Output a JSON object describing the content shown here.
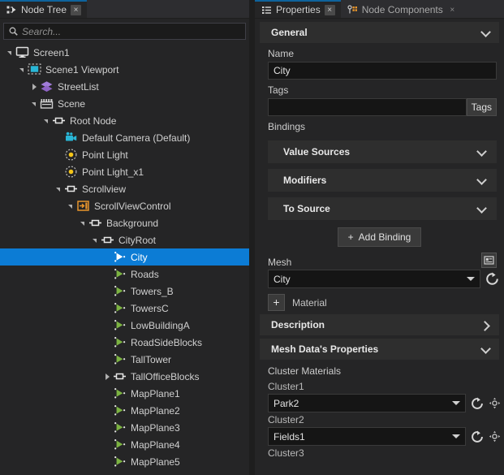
{
  "left_panel": {
    "tab": {
      "label": "Node Tree",
      "icon": "node-tree-icon",
      "close": "×"
    },
    "search": {
      "placeholder": "Search...",
      "value": "",
      "icon": "search-icon"
    },
    "tree": {
      "selected": "City",
      "nodes": [
        {
          "label": "Screen1",
          "depth": 0,
          "icon": "monitor-icon",
          "twisty": "down"
        },
        {
          "label": "Scene1 Viewport",
          "depth": 1,
          "icon": "viewport-icon",
          "twisty": "down"
        },
        {
          "label": "StreetList",
          "depth": 2,
          "icon": "layers-icon",
          "twisty": "right"
        },
        {
          "label": "Scene",
          "depth": 2,
          "icon": "clapper-icon",
          "twisty": "down"
        },
        {
          "label": "Root Node",
          "depth": 3,
          "icon": "node-icon",
          "twisty": "down"
        },
        {
          "label": "Default Camera (Default)",
          "depth": 4,
          "icon": "camera-icon",
          "twisty": "none"
        },
        {
          "label": "Point Light",
          "depth": 4,
          "icon": "point-light-icon",
          "twisty": "none"
        },
        {
          "label": "Point Light_x1",
          "depth": 4,
          "icon": "point-light-icon",
          "twisty": "none"
        },
        {
          "label": "Scrollview",
          "depth": 4,
          "icon": "node-icon",
          "twisty": "down"
        },
        {
          "label": "ScrollViewControl",
          "depth": 5,
          "icon": "scrollview-icon",
          "twisty": "down"
        },
        {
          "label": "Background",
          "depth": 6,
          "icon": "node-icon",
          "twisty": "down"
        },
        {
          "label": "CityRoot",
          "depth": 7,
          "icon": "node-icon",
          "twisty": "down"
        },
        {
          "label": "City",
          "depth": 8,
          "icon": "mesh-icon",
          "twisty": "none"
        },
        {
          "label": "Roads",
          "depth": 8,
          "icon": "mesh-icon",
          "twisty": "none"
        },
        {
          "label": "Towers_B",
          "depth": 8,
          "icon": "mesh-icon",
          "twisty": "none"
        },
        {
          "label": "TowersC",
          "depth": 8,
          "icon": "mesh-icon",
          "twisty": "none"
        },
        {
          "label": "LowBuildingA",
          "depth": 8,
          "icon": "mesh-icon",
          "twisty": "none"
        },
        {
          "label": "RoadSideBlocks",
          "depth": 8,
          "icon": "mesh-icon",
          "twisty": "none"
        },
        {
          "label": "TallTower",
          "depth": 8,
          "icon": "mesh-icon",
          "twisty": "none"
        },
        {
          "label": "TallOfficeBlocks",
          "depth": 8,
          "icon": "node-icon",
          "twisty": "right"
        },
        {
          "label": "MapPlane1",
          "depth": 8,
          "icon": "mesh-icon",
          "twisty": "none"
        },
        {
          "label": "MapPlane2",
          "depth": 8,
          "icon": "mesh-icon",
          "twisty": "none"
        },
        {
          "label": "MapPlane3",
          "depth": 8,
          "icon": "mesh-icon",
          "twisty": "none"
        },
        {
          "label": "MapPlane4",
          "depth": 8,
          "icon": "mesh-icon",
          "twisty": "none"
        },
        {
          "label": "MapPlane5",
          "depth": 8,
          "icon": "mesh-icon",
          "twisty": "none"
        }
      ]
    }
  },
  "right_panel": {
    "tabs": [
      {
        "label": "Properties",
        "icon": "properties-icon",
        "active": true,
        "close": "×"
      },
      {
        "label": "Node Components",
        "icon": "node-components-icon",
        "active": false,
        "close": "×"
      }
    ],
    "general": {
      "title": "General",
      "chevron": "chevron-down"
    },
    "name": {
      "label": "Name",
      "value": "City"
    },
    "tags": {
      "label": "Tags",
      "value": "",
      "button": "Tags"
    },
    "bindings": {
      "label": "Bindings",
      "panels": [
        {
          "title": "Value Sources",
          "chevron": "chevron-down"
        },
        {
          "title": "Modifiers",
          "chevron": "chevron-down"
        },
        {
          "title": "To Source",
          "chevron": "chevron-down"
        }
      ],
      "add_button": {
        "label": "Add Binding",
        "plus": "+"
      }
    },
    "mesh": {
      "label": "Mesh",
      "value": "City",
      "picker_icon": "mesh-picker-icon",
      "reset_icon": "reset-icon"
    },
    "material": {
      "label": "Material",
      "plus": "+"
    },
    "description": {
      "title": "Description",
      "chevron": "chevron-right"
    },
    "mesh_data_properties": {
      "title": "Mesh Data's Properties",
      "chevron": "chevron-down"
    },
    "cluster_materials": {
      "label": "Cluster Materials",
      "clusters": [
        {
          "label": "Cluster1",
          "value": "Park2",
          "reset_icon": "reset-icon",
          "locate_icon": "locate-icon"
        },
        {
          "label": "Cluster2",
          "value": "Fields1",
          "reset_icon": "reset-icon",
          "locate_icon": "locate-icon"
        },
        {
          "label": "Cluster3",
          "value": "",
          "reset_icon": "reset-icon",
          "locate_icon": "locate-icon"
        }
      ]
    }
  },
  "colors": {
    "accent_selection": "#0c7cd5",
    "tab_accent": "#0e639c",
    "mesh_icon": "#7cb342",
    "light_icon": "#f5c518",
    "camera_icon": "#29b6d6",
    "layers_icon": "#a07cd8",
    "viewport_icon": "#29b6d6",
    "scrollview_icon": "#e8952c",
    "panel_bg": "#252526",
    "field_bg": "#151515"
  }
}
